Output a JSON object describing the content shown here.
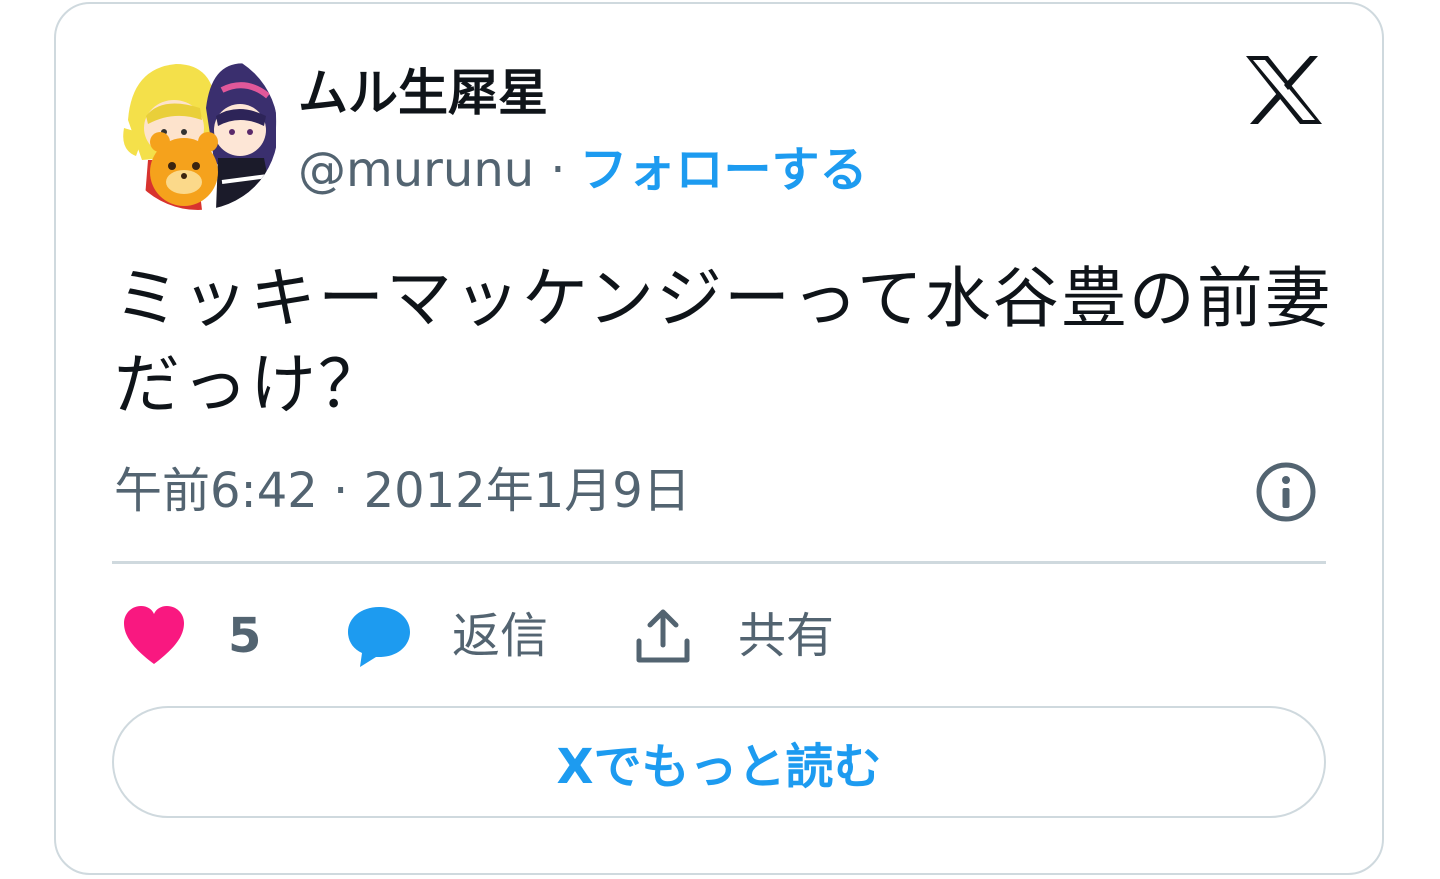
{
  "tweet": {
    "author": {
      "display_name": "ムル生犀星",
      "handle": "@murunu",
      "separator": "·",
      "follow_label": "フォローする"
    },
    "text": "ミッキーマッケンジーって水谷豊の前妻だっけ？",
    "timestamp": "午前6:42 · 2012年1月9日",
    "actions": {
      "like_count": "5",
      "reply_label": "返信",
      "share_label": "共有"
    },
    "read_more_label": "Xでもっと読む"
  },
  "icons": {
    "brand": "x-logo-icon",
    "info": "info-icon",
    "like": "heart-icon",
    "reply": "speech-bubble-icon",
    "share": "upload-arrow-icon"
  },
  "colors": {
    "accent": "#1d9bf0",
    "like": "#f91880",
    "text_primary": "#0f1419",
    "text_secondary": "#536471",
    "border": "#cfd9de"
  }
}
